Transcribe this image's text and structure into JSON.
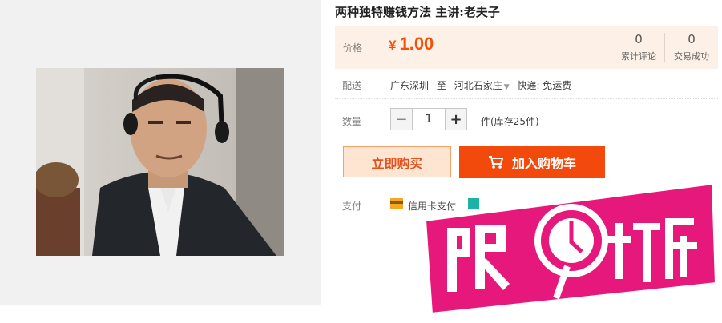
{
  "product": {
    "title": "两种独特赚钱方法 主讲:老夫子"
  },
  "price": {
    "label": "价格",
    "currency": "¥",
    "value": "1.00",
    "accent_color": "#f2510a"
  },
  "stats": [
    {
      "count": "0",
      "label": "累计评论"
    },
    {
      "count": "0",
      "label": "交易成功"
    }
  ],
  "shipping": {
    "label": "配送",
    "from": "广东深圳",
    "to_word": "至",
    "to": "河北石家庄",
    "method": "快递: 免运费"
  },
  "quantity": {
    "label": "数量",
    "value": "1",
    "minus": "−",
    "plus": "+",
    "stock": "件(库存25件)"
  },
  "actions": {
    "buy_now": "立即购买",
    "add_to_cart": "加入购物车"
  },
  "payment": {
    "label": "支付",
    "method_1": "信用卡支付"
  },
  "promo": {
    "badge_text": "限时打折",
    "badge_color": "#e6187b"
  }
}
